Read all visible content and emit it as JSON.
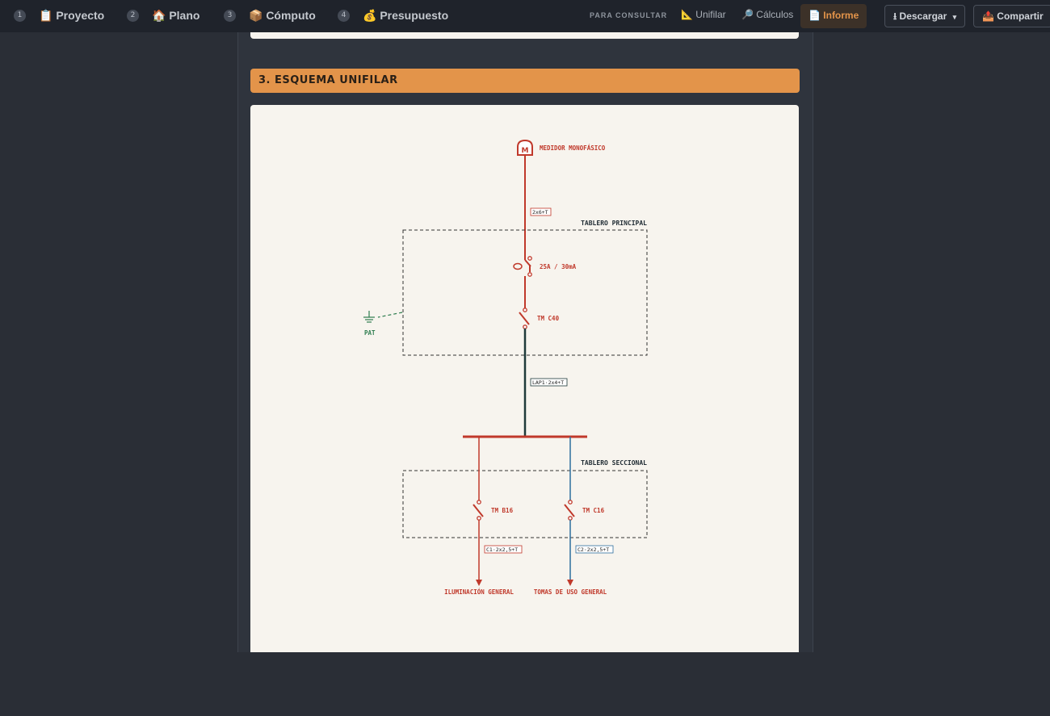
{
  "steps": [
    {
      "num": "1",
      "label": "📋 Proyecto"
    },
    {
      "num": "2",
      "label": "🏠 Plano"
    },
    {
      "num": "3",
      "label": "📦 Cómputo"
    },
    {
      "num": "4",
      "label": "💰 Presupuesto"
    }
  ],
  "nav": {
    "consult_label": "PARA CONSULTAR",
    "unifilar": "📐 Unifilar",
    "calculos": "🔎 Cálculos",
    "informe": "📄 Informe",
    "download": "⭳ Descargar",
    "download_caret": "▾",
    "share": "📤 Compartir"
  },
  "section": {
    "title": "3. ESQUEMA UNIFILAR"
  },
  "diagram": {
    "meter_symbol": "M",
    "meter_label": "MEDIDOR MONOFÁSICO",
    "feeder_cable": "2x6+T",
    "main_board_label": "TABLERO PRINCIPAL",
    "rcd_label": "25A / 30mA",
    "main_breaker_label": "TM C40",
    "ground_label": "PAT",
    "lap_cable": "LAP1·2x4+T",
    "secondary_board_label": "TABLERO SECCIONAL",
    "circuit1_breaker": "TM B16",
    "circuit2_breaker": "TM C16",
    "circuit1_cable": "C1·2x2,5+T",
    "circuit2_cable": "C2·2x2,5+T",
    "circuit1_name": "ILUMINACIÓN GENERAL",
    "circuit2_name": "TOMAS DE USO GENERAL",
    "colors": {
      "red": "#c0392b",
      "blue": "#2e6f9e",
      "dark": "#1f3a3a",
      "green": "#2e7d4f"
    }
  }
}
